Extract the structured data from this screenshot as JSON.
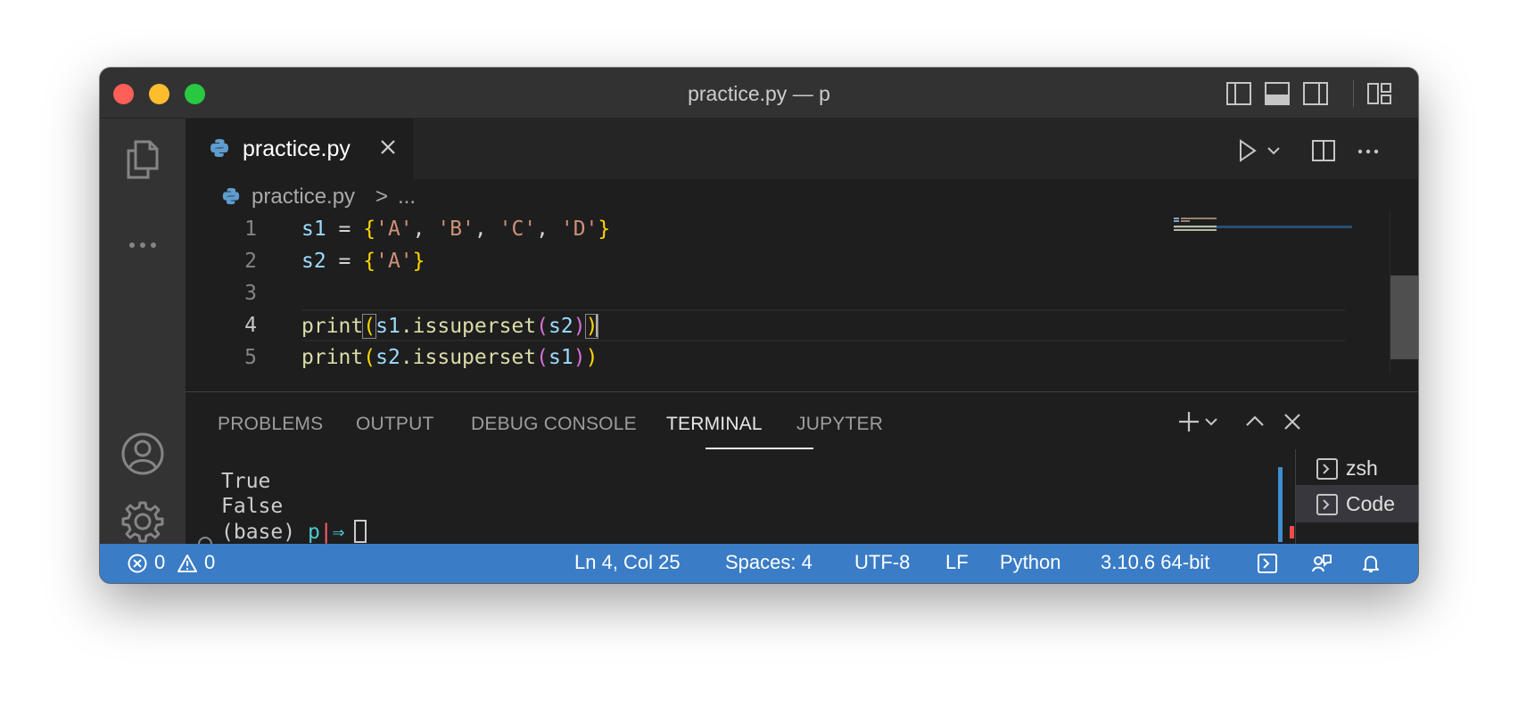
{
  "window": {
    "title": "practice.py — p"
  },
  "editor": {
    "tab_label": "practice.py",
    "breadcrumb_file": "practice.py",
    "breadcrumb_separator": ">",
    "breadcrumb_more": "...",
    "line_numbers": [
      "1",
      "2",
      "3",
      "4",
      "5"
    ],
    "active_line": "4",
    "code": {
      "line1": {
        "a": "s1",
        "b": " = ",
        "c": "{",
        "d": "'A'",
        "e": ", ",
        "f": "'B'",
        "g": ", ",
        "h": "'C'",
        "i": ", ",
        "j": "'D'",
        "k": "}"
      },
      "line2": {
        "a": "s2",
        "b": " = ",
        "c": "{",
        "d": "'A'",
        "e": "}"
      },
      "line4": {
        "a": "print",
        "b": "(",
        "c": "s1",
        "d": ".issuperset",
        "e": "(",
        "f": "s2",
        "g": ")",
        "h": ")"
      },
      "line5": {
        "a": "print",
        "b": "(",
        "c": "s2",
        "d": ".issuperset",
        "e": "(",
        "f": "s1",
        "g": ")",
        "h": ")"
      }
    }
  },
  "panel": {
    "tabs": [
      "PROBLEMS",
      "OUTPUT",
      "DEBUG CONSOLE",
      "TERMINAL",
      "JUPYTER"
    ],
    "active_tab": "TERMINAL",
    "terminal": {
      "lines": [
        "True",
        "False"
      ],
      "prompt_env": "(base) ",
      "prompt_dir": "p",
      "prompt_sep": "|",
      "prompt_arrow": "⇒"
    },
    "terminal_list": [
      "zsh",
      "Code"
    ],
    "selected_terminal": "Code"
  },
  "statusbar": {
    "errors": "0",
    "warnings": "0",
    "position": "Ln 4, Col 25",
    "spaces": "Spaces: 4",
    "encoding": "UTF-8",
    "eol": "LF",
    "language": "Python",
    "interpreter": "3.10.6 64-bit"
  },
  "colors": {
    "statusbar": "#3a7cc6",
    "titlebar": "#323233",
    "activity_bar": "#333333",
    "editor_bg": "#1e1e1e"
  }
}
